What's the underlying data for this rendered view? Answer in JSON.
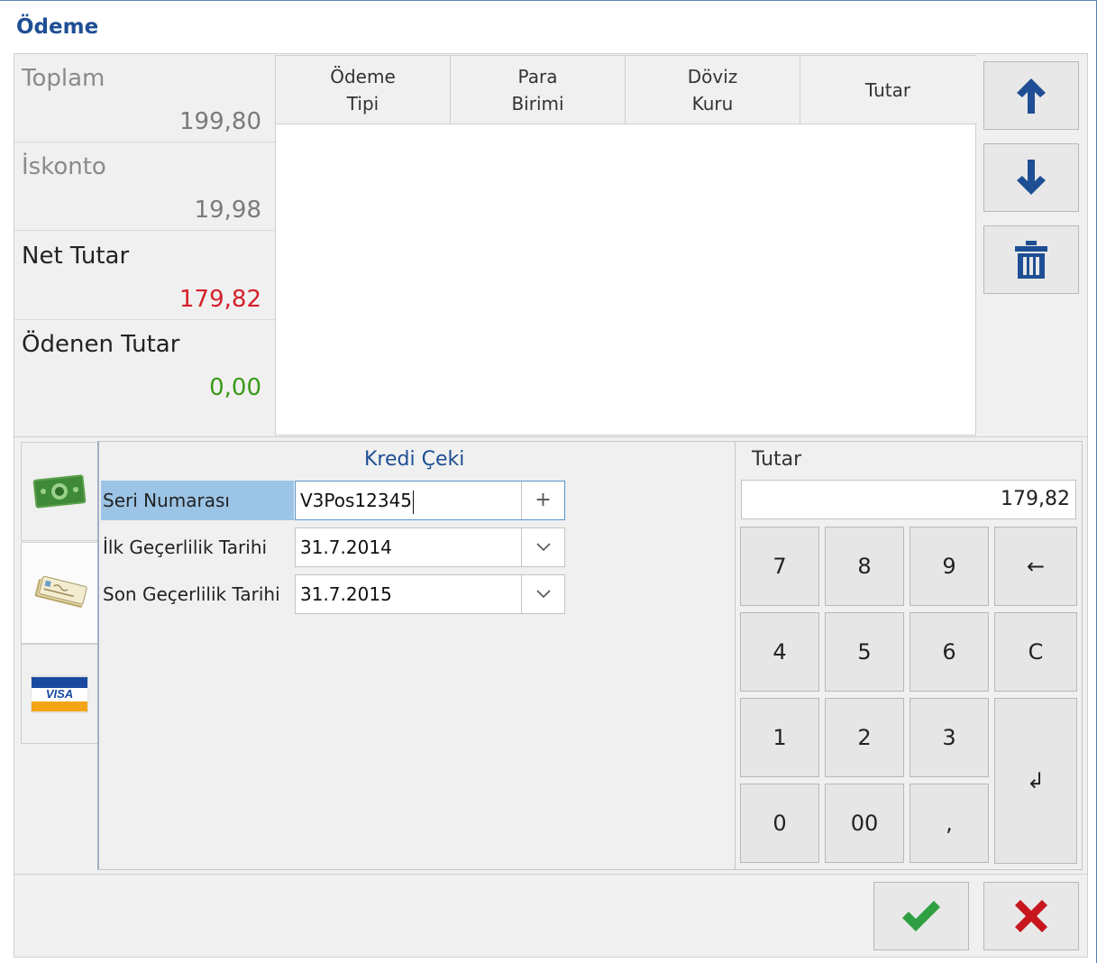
{
  "window": {
    "title": "Ödeme"
  },
  "summary": {
    "items": [
      {
        "label": "Toplam",
        "value": "199,80",
        "label_color": "#8a8a8a",
        "value_color": "#7a7a7a"
      },
      {
        "label": "İskonto",
        "value": "19,98",
        "label_color": "#8a8a8a",
        "value_color": "#7a7a7a"
      },
      {
        "label": "Net Tutar",
        "value": "179,82",
        "label_color": "#222222",
        "value_color": "#d4202a"
      },
      {
        "label": "Ödenen Tutar",
        "value": "0,00",
        "label_color": "#222222",
        "value_color": "#3a9a1a"
      }
    ]
  },
  "grid": {
    "columns": [
      {
        "line1": "Ödeme",
        "line2": "Tipi"
      },
      {
        "line1": "Para",
        "line2": "Birimi"
      },
      {
        "line1": "Döviz",
        "line2": "Kuru"
      },
      {
        "line1": "Tutar",
        "line2": ""
      }
    ],
    "rows": []
  },
  "side_buttons": [
    {
      "icon": "arrow-up-icon"
    },
    {
      "icon": "arrow-down-icon"
    },
    {
      "icon": "trash-icon"
    }
  ],
  "tabs": [
    {
      "icon": "cash-icon",
      "active": false
    },
    {
      "icon": "cheque-icon",
      "active": true
    },
    {
      "icon": "visa-card-icon",
      "active": false,
      "text": "VISA"
    }
  ],
  "form": {
    "title": "Kredi Çeki",
    "serial": {
      "label": "Seri Numarası",
      "value": "V3Pos12345",
      "button": "+"
    },
    "valid_from": {
      "label": "İlk Geçerlilik Tarihi",
      "value": "31.7.2014"
    },
    "valid_to": {
      "label": "Son Geçerlilik Tarihi",
      "value": "31.7.2015"
    }
  },
  "keypad": {
    "title": "Tutar",
    "amount": "179,82",
    "keys": [
      "7",
      "8",
      "9",
      "4",
      "5",
      "6",
      "1",
      "2",
      "3",
      "0",
      "00",
      ","
    ],
    "backspace": "←",
    "clear": "C",
    "enter": "↲"
  },
  "colors": {
    "accent": "#1e4f94",
    "ok": "#2ea043",
    "cancel": "#c8161e",
    "selection": "#9cc4e6"
  }
}
